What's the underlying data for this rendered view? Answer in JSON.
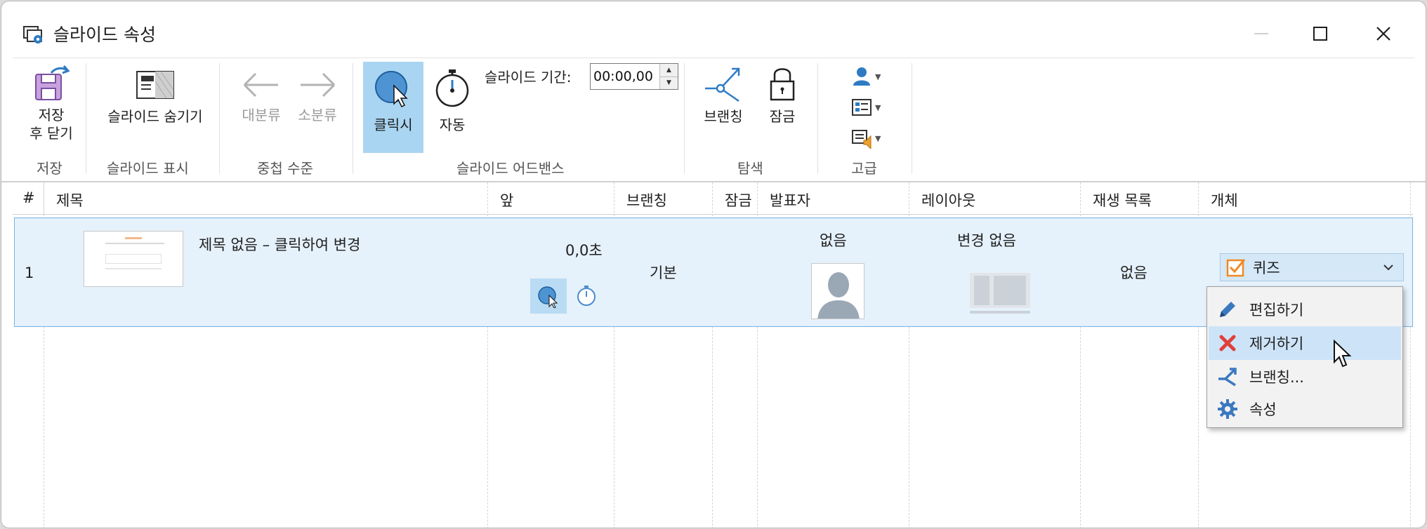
{
  "window": {
    "title": "슬라이드 속성"
  },
  "ribbon": {
    "save_group": {
      "label": "저장",
      "button_line1": "저장",
      "button_line2": "후 닫기"
    },
    "display_group": {
      "label": "슬라이드 표시",
      "hide_button": "슬라이드 숨기기"
    },
    "nesting_group": {
      "label": "중첩 수준",
      "promote": "대분류",
      "demote": "소분류"
    },
    "advance_group": {
      "label": "슬라이드 어드밴스",
      "on_click": "클릭시",
      "auto": "자동",
      "duration_label": "슬라이드 기간:",
      "duration_value": "00:00,00"
    },
    "navigation_group": {
      "label": "탐색",
      "branching": "브랜칭",
      "lock": "잠금"
    },
    "advanced_group": {
      "label": "고급"
    }
  },
  "table": {
    "columns": [
      "#",
      "제목",
      "앞",
      "브랜칭",
      "잠금",
      "발표자",
      "레이아웃",
      "재생 목록",
      "개체"
    ],
    "row": {
      "number": "1",
      "title": "제목 없음 – 클릭하여 변경",
      "advance_time": "0,0초",
      "branching": "기본",
      "presenter": "없음",
      "layout": "변경 없음",
      "playlist": "없음",
      "object": "퀴즈"
    }
  },
  "context_menu": {
    "items": [
      "편집하기",
      "제거하기",
      "브랜칭...",
      "속성"
    ],
    "hovered_index": 1
  },
  "colors": {
    "accent": "#2e7bc4",
    "row_bg": "#e5f1fb",
    "active_button": "#a9d5f2",
    "remove_red": "#e0413a",
    "quiz_orange": "#f08a24"
  }
}
